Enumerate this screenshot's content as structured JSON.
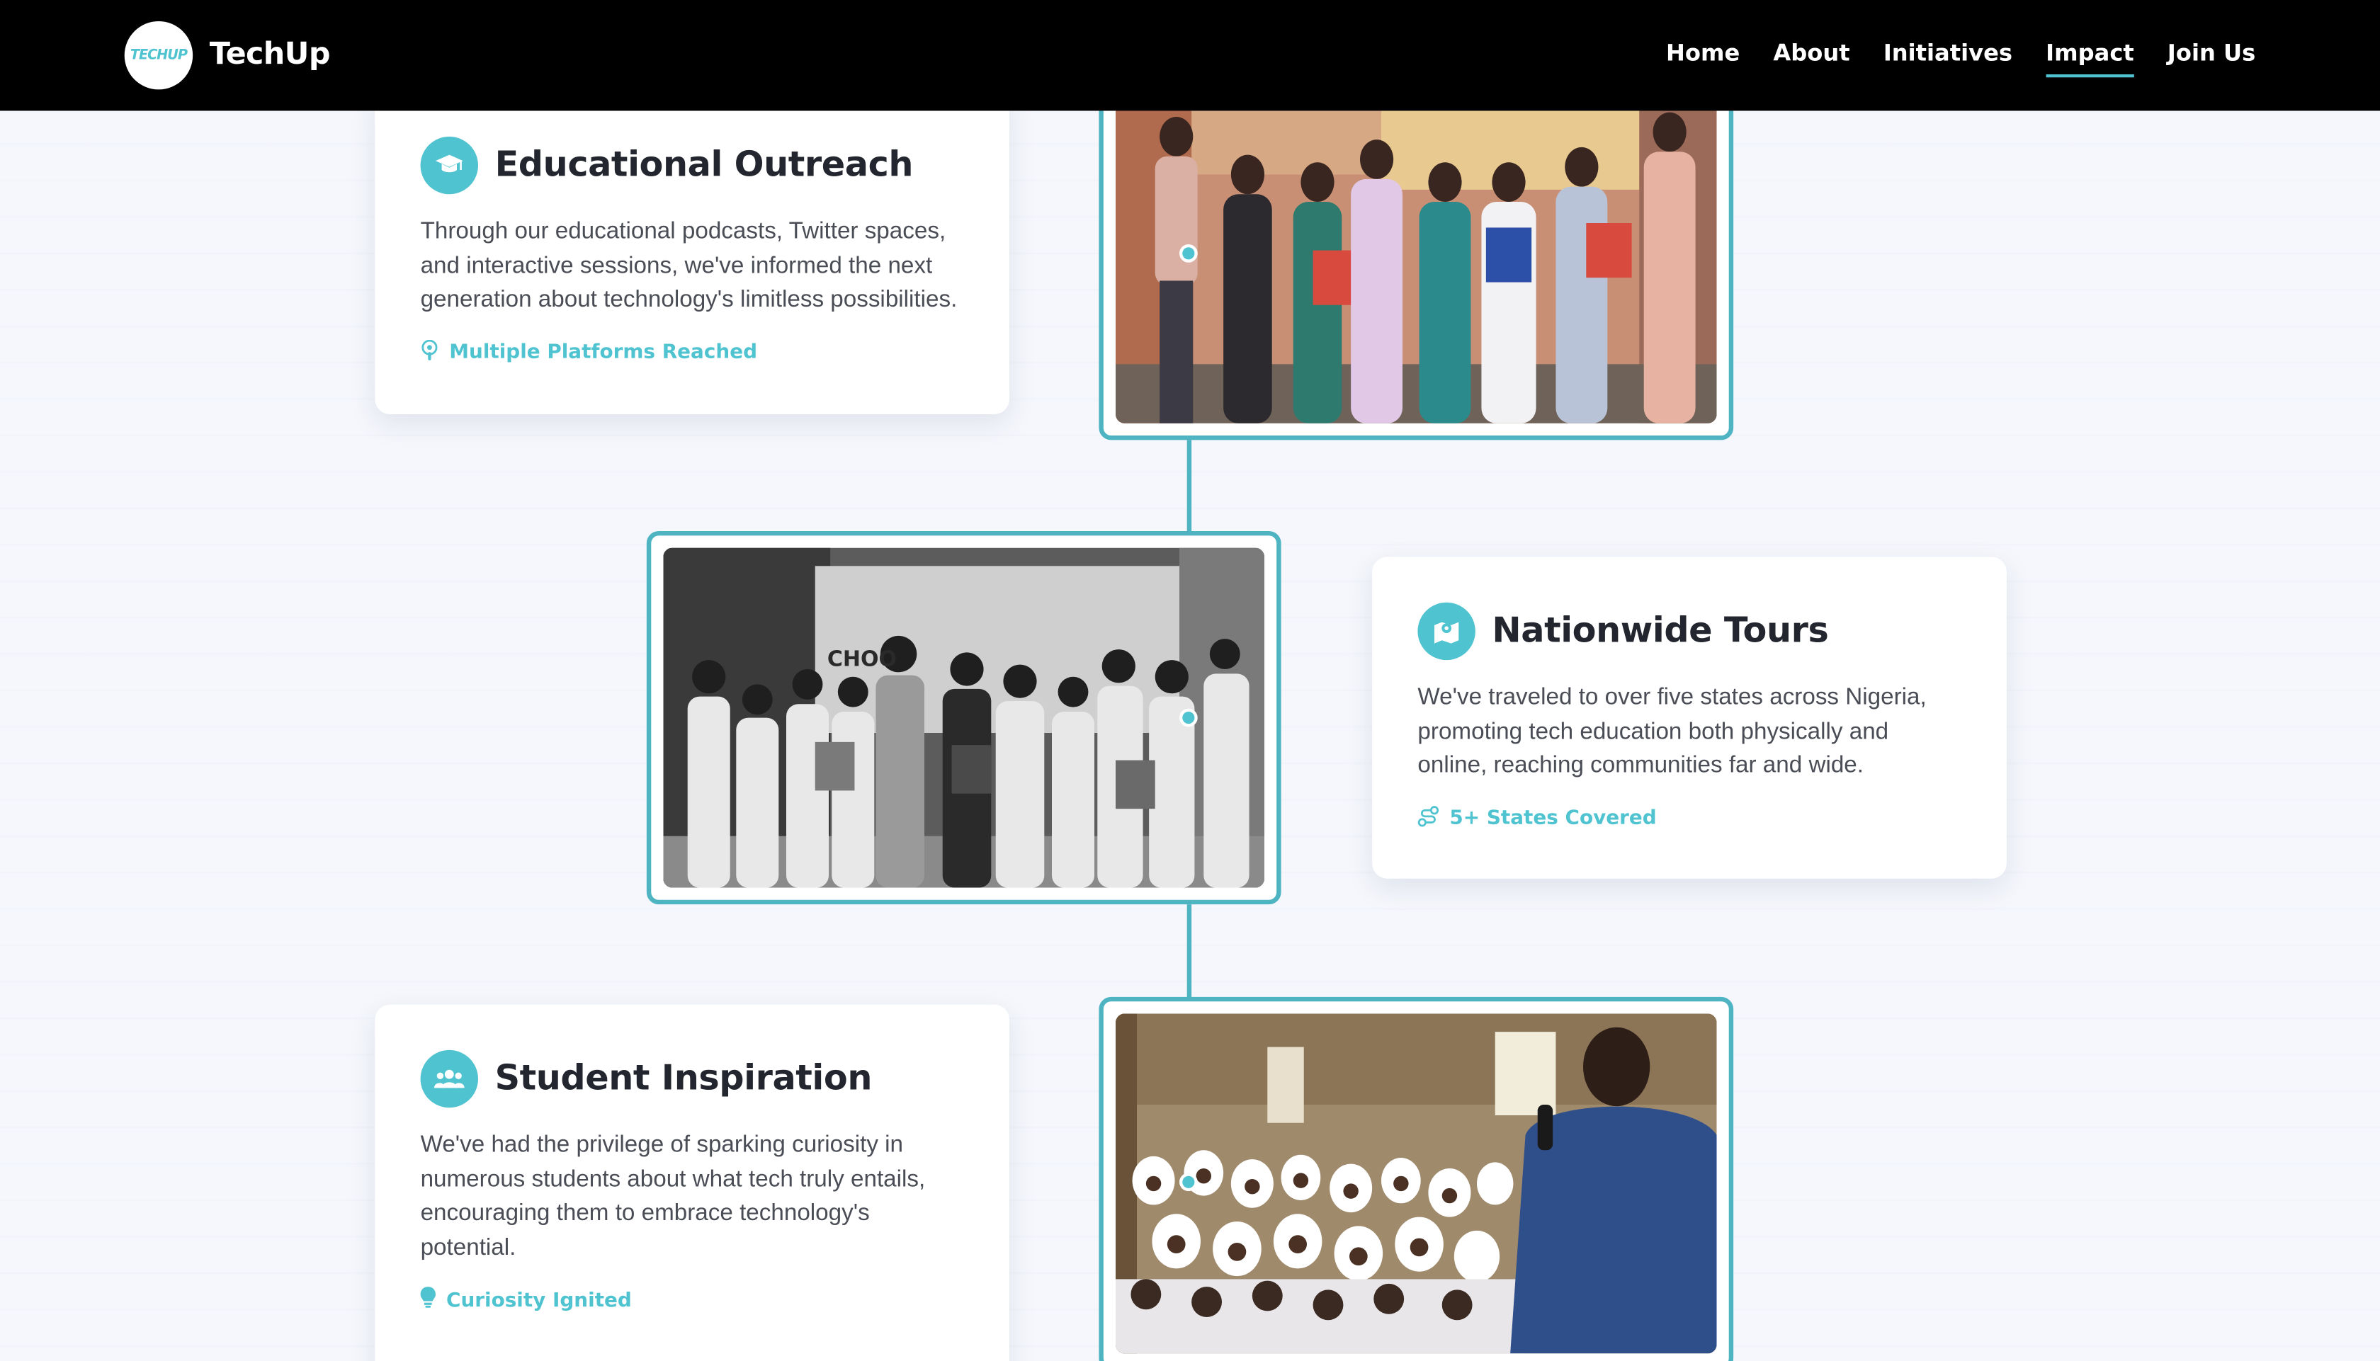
{
  "brand": {
    "logo_text": "TECHUP",
    "name": "TechUp"
  },
  "nav": {
    "items": [
      {
        "label": "Home",
        "active": false
      },
      {
        "label": "About",
        "active": false
      },
      {
        "label": "Initiatives",
        "active": false
      },
      {
        "label": "Impact",
        "active": true
      },
      {
        "label": "Join Us",
        "active": false
      }
    ]
  },
  "colors": {
    "accent": "#4fc3d0",
    "line": "#4fb4c2",
    "nav_bg": "#000000",
    "page_bg": "#f5f7fc"
  },
  "timeline": [
    {
      "title": "Educational Outreach",
      "icon": "graduation-cap-icon",
      "body": "Through our educational podcasts, Twitter spaces, and interactive sessions, we've informed the next generation about technology's limitless possibilities.",
      "stat_icon": "podcast-icon",
      "stat": "Multiple Platforms Reached",
      "photo": "group-photo-color"
    },
    {
      "title": "Nationwide Tours",
      "icon": "map-marked-icon",
      "body": "We've traveled to over five states across Nigeria, promoting tech education both physically and online, reaching communities far and wide.",
      "stat_icon": "route-icon",
      "stat": "5+ States Covered",
      "photo": "students-photo-grayscale"
    },
    {
      "title": "Student Inspiration",
      "icon": "users-icon",
      "body": "We've had the privilege of sparking curiosity in numerous students about what tech truly entails, encouraging them to embrace technology's potential.",
      "stat_icon": "lightbulb-icon",
      "stat": "Curiosity Ignited",
      "photo": "classroom-photo-color"
    }
  ]
}
